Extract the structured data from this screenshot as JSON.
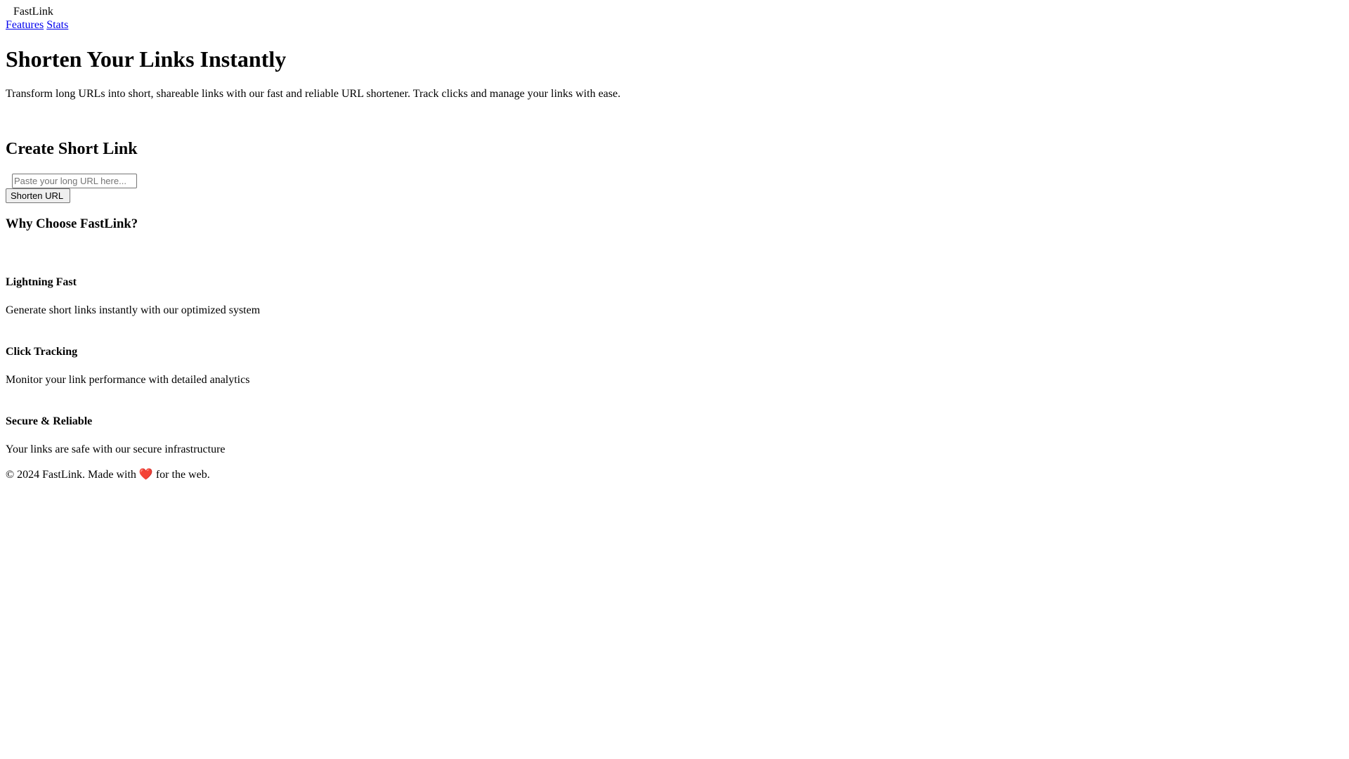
{
  "header": {
    "logo_icon": "link-icon",
    "logo_text": "FastLink",
    "nav": [
      {
        "label": "Features"
      },
      {
        "label": "Stats"
      }
    ]
  },
  "hero": {
    "title": "Shorten Your Links Instantly",
    "subtitle": "Transform long URLs into short, shareable links with our fast and reliable URL shortener. Track clicks and manage your links with ease."
  },
  "shortener": {
    "icon": "magic-icon",
    "title": "Create Short Link",
    "input_icon": "link-icon",
    "input_placeholder": "Paste your long URL here...",
    "input_value": "",
    "button_label": "Shorten URL",
    "button_icon": "arrow-right-icon"
  },
  "features": {
    "title": "Why Choose FastLink?",
    "items": [
      {
        "icon": "bolt-icon",
        "title": "Lightning Fast",
        "description": "Generate short links instantly with our optimized system"
      },
      {
        "icon": "chart-icon",
        "title": "Click Tracking",
        "description": "Monitor your link performance with detailed analytics"
      },
      {
        "icon": "shield-icon",
        "title": "Secure & Reliable",
        "description": "Your links are safe with our secure infrastructure"
      }
    ]
  },
  "footer": {
    "prefix": "© 2024 FastLink. Made with",
    "heart": "❤️",
    "suffix": "for the web."
  },
  "colors": {
    "link": "#0000ee",
    "heart": "#e0245e"
  }
}
